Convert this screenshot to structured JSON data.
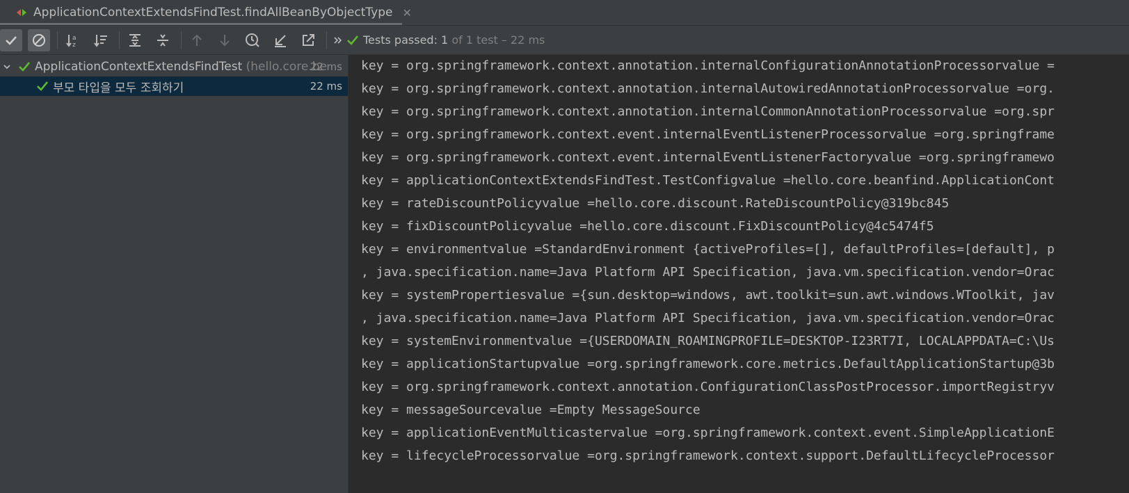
{
  "tab": {
    "title": "ApplicationContextExtendsFindTest.findAllBeanByObjectType",
    "close_glyph": "✕"
  },
  "status": {
    "passed_prefix": "Tests passed: ",
    "passed_count": "1",
    "of_text": " of 1 test – 22 ms"
  },
  "tree": {
    "root": {
      "name": "ApplicationContextExtendsFindTest",
      "package": " (hello.core.be",
      "duration": "22 ms"
    },
    "child": {
      "name": "부모 타입을 모두 조회하기",
      "duration": "22 ms"
    }
  },
  "console": {
    "lines": [
      "key = org.springframework.context.annotation.internalConfigurationAnnotationProcessorvalue =",
      "key = org.springframework.context.annotation.internalAutowiredAnnotationProcessorvalue =org.",
      "key = org.springframework.context.annotation.internalCommonAnnotationProcessorvalue =org.spr",
      "key = org.springframework.context.event.internalEventListenerProcessorvalue =org.springframe",
      "key = org.springframework.context.event.internalEventListenerFactoryvalue =org.springframewo",
      "key = applicationContextExtendsFindTest.TestConfigvalue =hello.core.beanfind.ApplicationCont",
      "key = rateDiscountPolicyvalue =hello.core.discount.RateDiscountPolicy@319bc845",
      "key = fixDiscountPolicyvalue =hello.core.discount.FixDiscountPolicy@4c5474f5",
      "key = environmentvalue =StandardEnvironment {activeProfiles=[], defaultProfiles=[default], p",
      ", java.specification.name=Java Platform API Specification, java.vm.specification.vendor=Orac",
      "key = systemPropertiesvalue ={sun.desktop=windows, awt.toolkit=sun.awt.windows.WToolkit, jav",
      ", java.specification.name=Java Platform API Specification, java.vm.specification.vendor=Orac",
      "key = systemEnvironmentvalue ={USERDOMAIN_ROAMINGPROFILE=DESKTOP-I23RT7I, LOCALAPPDATA=C:\\Us",
      "key = applicationStartupvalue =org.springframework.core.metrics.DefaultApplicationStartup@3b",
      "key = org.springframework.context.annotation.ConfigurationClassPostProcessor.importRegistryv",
      "key = messageSourcevalue =Empty MessageSource",
      "key = applicationEventMulticastervalue =org.springframework.context.event.SimpleApplicationE",
      "key = lifecycleProcessorvalue =org.springframework.context.support.DefaultLifecycleProcessor"
    ]
  },
  "colors": {
    "success_green": "#5fb832",
    "background": "#2b2b2b",
    "panel": "#3c3f41",
    "selection": "#0d293e"
  },
  "icons": {
    "tab": "run-test-icon",
    "toolbar": [
      "show-passed-icon",
      "show-ignored-icon",
      "sort-alphabetically-icon",
      "sort-by-duration-icon",
      "expand-all-icon",
      "collapse-all-icon",
      "previous-failed-icon",
      "next-failed-icon",
      "test-history-icon",
      "import-tests-icon",
      "export-tests-icon",
      "more-chevron-icon"
    ],
    "status": "check-icon"
  }
}
